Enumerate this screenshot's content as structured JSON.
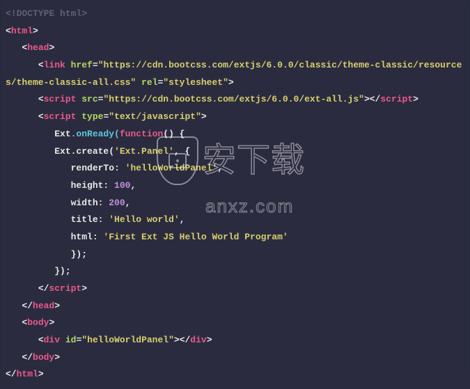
{
  "code": {
    "doctype": "<!DOCTYPE html>",
    "html_open": "html",
    "head_open": "head",
    "link_tag": "link",
    "link_href_attr": "href",
    "link_href_val": "\"https://cdn.bootcss.com/extjs/6.0.0/classic/theme-classic/resources/theme-classic-all.css\"",
    "link_rel_attr": "rel",
    "link_rel_val": "\"stylesheet\"",
    "script1_tag": "script",
    "script1_src_attr": "src",
    "script1_src_val": "\"https://cdn.bootcss.com/extjs/6.0.0/ext-all.js\"",
    "script1_close": "script",
    "script2_tag": "script",
    "script2_type_attr": "type",
    "script2_type_val": "\"text/javascript\"",
    "js_ext": "Ext",
    "js_onready": ".onReady(",
    "js_function": "function",
    "js_onready_tail": "() {",
    "js_create_head": "Ext.create(",
    "js_panel_str": "'Ext.Panel'",
    "js_create_tail": ", {",
    "prop_renderTo": "renderTo: ",
    "val_renderTo": "'helloWorldPanel'",
    "prop_height": "height: ",
    "val_height": "100",
    "prop_width": "width: ",
    "val_width": "200",
    "prop_title": "title: ",
    "val_title": "'Hello world'",
    "prop_html": "html: ",
    "val_html": "'First Ext JS Hello World Program'",
    "close_obj": "});",
    "close_fn": "});",
    "script2_close": "script",
    "head_close": "head",
    "body_open": "body",
    "div_tag": "div",
    "div_id_attr": "id",
    "div_id_val": "\"helloWorldPanel\"",
    "div_close": "div",
    "body_close": "body",
    "html_close": "html"
  },
  "watermark": {
    "line1": "安下载",
    "line2": "anxz.com"
  }
}
